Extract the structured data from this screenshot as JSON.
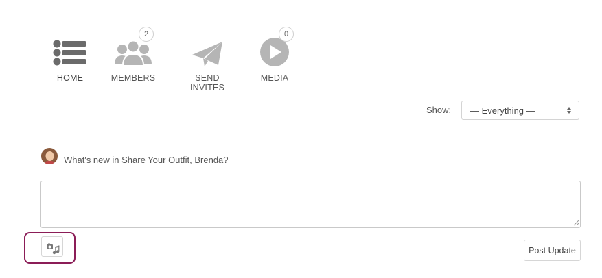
{
  "nav": {
    "items": [
      {
        "label": "HOME",
        "icon": "list-icon",
        "active": true
      },
      {
        "label": "MEMBERS",
        "icon": "members-icon",
        "count": "2"
      },
      {
        "label": "SEND INVITES",
        "icon": "paper-plane-icon"
      },
      {
        "label": "MEDIA",
        "icon": "play-icon",
        "count": "0"
      }
    ]
  },
  "filter": {
    "label": "Show:",
    "selected": "— Everything —"
  },
  "composer": {
    "prompt": "What's new in Share Your Outfit, Brenda?",
    "textarea_value": "",
    "post_label": "Post Update"
  },
  "colors": {
    "icon_gray": "#b5b5b5",
    "home_icon": "#6b6b6b",
    "highlight": "#8b1d57"
  }
}
